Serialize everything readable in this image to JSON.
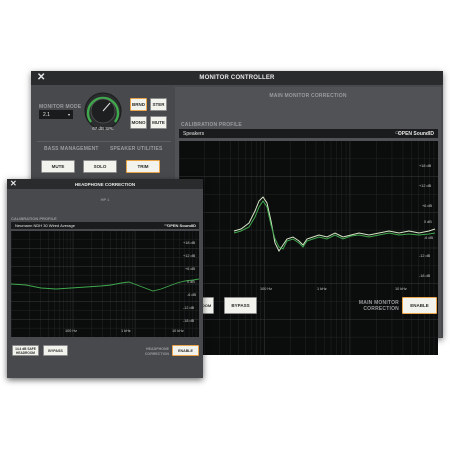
{
  "main_window": {
    "title": "MONITOR CONTROLLER",
    "monitor_mode_label": "MONITOR MODE",
    "monitor_mode_value": "2.1",
    "knob_readout": "67 dB SPL",
    "buttons": {
      "brnd": "BRND",
      "ster": "STER",
      "mono": "MONO",
      "mute": "MUTE"
    },
    "tabs": {
      "bass_management": "BASS MANAGEMENT",
      "speaker_utilities": "SPEAKER UTILITIES"
    },
    "utility_buttons": {
      "mute": "MUTE",
      "solo": "SOLO",
      "trim": "TRIM"
    },
    "section_title": "MAIN MONITOR CORRECTION",
    "calibration_profile_label": "CALIBRATION PROFILE",
    "profile_value": "Speakers",
    "open_soundid": "OPEN SoundID",
    "y_ticks": [
      "+18 dB",
      "+12 dB",
      "+6 dB",
      "0 dB",
      "-6 dB",
      "-12 dB",
      "-18 dB"
    ],
    "x_ticks": [
      "100 Hz",
      "1 kHz",
      "10 kHz"
    ],
    "bottom_buttons": {
      "headroom_partial": "DOM",
      "bypass": "BYPASS",
      "enable": "ENABLE"
    },
    "correction_label": "MAIN MONITOR\nCORRECTION"
  },
  "headphone_window": {
    "title": "HEADPHONE CORRECTION",
    "section_title": "HP 1",
    "calibration_profile_label": "CALIBRATION PROFILE",
    "profile_value": "Neumann NDH 30 Wired Average",
    "open_soundid": "OPEN SoundID",
    "y_ticks": [
      "+18 dB",
      "+12 dB",
      "+6 dB",
      "0 dB",
      "-6 dB",
      "-12 dB",
      "-18 dB"
    ],
    "x_ticks": [
      "100 Hz",
      "1 kHz",
      "10 kHz"
    ],
    "safe_headroom_line1": "14.4 dB SAFE",
    "safe_headroom_line2": "HEADROOM",
    "bypass": "BYPASS",
    "correction_label": "HEADPHONE\nCORRECTION",
    "enable": "ENABLE"
  },
  "colors": {
    "window_bg": "#47494c",
    "titlebar": "#2a2b2d",
    "graph_bg": "#0b0c0c",
    "curve_green": "#3fa94d",
    "curve_light": "#d7e8c8",
    "selected_outline": "#e9a44a"
  }
}
